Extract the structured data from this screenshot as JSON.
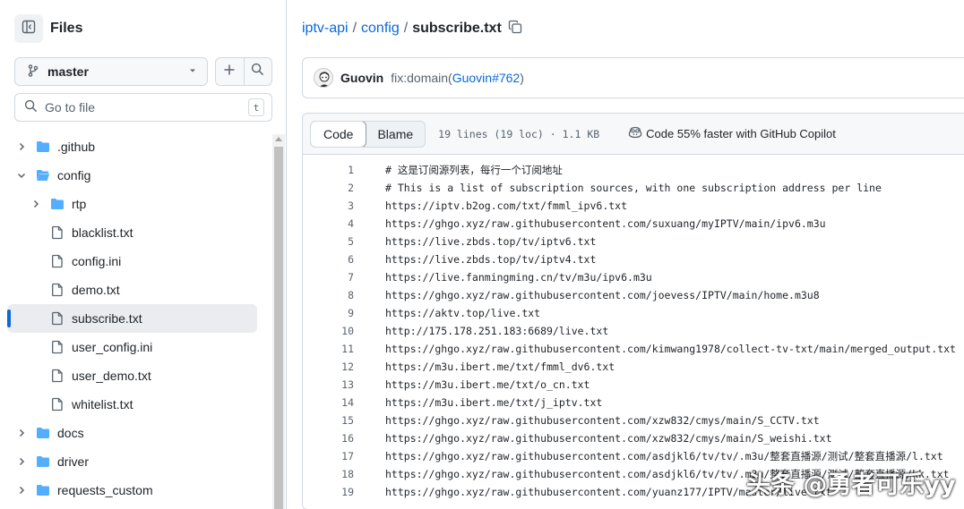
{
  "sidebar": {
    "title": "Files",
    "branch": "master",
    "goto_placeholder": "Go to file",
    "goto_shortcut": "t",
    "tree": [
      {
        "label": ".github",
        "type": "folder",
        "expanded": false,
        "depth": 0
      },
      {
        "label": "config",
        "type": "folder",
        "expanded": true,
        "depth": 0
      },
      {
        "label": "rtp",
        "type": "folder",
        "expanded": false,
        "depth": 1
      },
      {
        "label": "blacklist.txt",
        "type": "file",
        "depth": 1
      },
      {
        "label": "config.ini",
        "type": "file",
        "depth": 1
      },
      {
        "label": "demo.txt",
        "type": "file",
        "depth": 1
      },
      {
        "label": "subscribe.txt",
        "type": "file",
        "depth": 1,
        "selected": true
      },
      {
        "label": "user_config.ini",
        "type": "file",
        "depth": 1
      },
      {
        "label": "user_demo.txt",
        "type": "file",
        "depth": 1
      },
      {
        "label": "whitelist.txt",
        "type": "file",
        "depth": 1
      },
      {
        "label": "docs",
        "type": "folder",
        "expanded": false,
        "depth": 0
      },
      {
        "label": "driver",
        "type": "folder",
        "expanded": false,
        "depth": 0
      },
      {
        "label": "requests_custom",
        "type": "folder",
        "expanded": false,
        "depth": 0
      }
    ]
  },
  "breadcrumb": {
    "repo": "iptv-api",
    "sep1": "/",
    "folder": "config",
    "sep2": "/",
    "file": "subscribe.txt"
  },
  "commit": {
    "author": "Guovin",
    "message": "fix:domain",
    "ref_open": "(",
    "ref": "Guovin#762",
    "ref_close": ")"
  },
  "file_header": {
    "tab_code": "Code",
    "tab_blame": "Blame",
    "meta": "19 lines (19 loc) · 1.1 KB",
    "copilot_text": "Code 55% faster with GitHub Copilot"
  },
  "code_lines": [
    "# 这是订阅源列表，每行一个订阅地址",
    "# This is a list of subscription sources, with one subscription address per line",
    "https://iptv.b2og.com/txt/fmml_ipv6.txt",
    "https://ghgo.xyz/raw.githubusercontent.com/suxuang/myIPTV/main/ipv6.m3u",
    "https://live.zbds.top/tv/iptv6.txt",
    "https://live.zbds.top/tv/iptv4.txt",
    "https://live.fanmingming.cn/tv/m3u/ipv6.m3u",
    "https://ghgo.xyz/raw.githubusercontent.com/joevess/IPTV/main/home.m3u8",
    "https://aktv.top/live.txt",
    "http://175.178.251.183:6689/live.txt",
    "https://ghgo.xyz/raw.githubusercontent.com/kimwang1978/collect-tv-txt/main/merged_output.txt",
    "https://m3u.ibert.me/txt/fmml_dv6.txt",
    "https://m3u.ibert.me/txt/o_cn.txt",
    "https://m3u.ibert.me/txt/j_iptv.txt",
    "https://ghgo.xyz/raw.githubusercontent.com/xzw832/cmys/main/S_CCTV.txt",
    "https://ghgo.xyz/raw.githubusercontent.com/xzw832/cmys/main/S_weishi.txt",
    "https://ghgo.xyz/raw.githubusercontent.com/asdjkl6/tv/tv/.m3u/整套直播源/测试/整套直播源/l.txt",
    "https://ghgo.xyz/raw.githubusercontent.com/asdjkl6/tv/tv/.m3u/整套直播源/测试/整套直播源/kk.txt",
    "https://ghgo.xyz/raw.githubusercontent.com/yuanz177/IPTV/master/live.txt"
  ],
  "watermark": "头条 @勇者可乐yy",
  "colors": {
    "link": "#0969da",
    "folder": "#54aeff",
    "border": "#d1d9e0",
    "muted": "#59636e",
    "selected_indicator": "#0969da"
  }
}
